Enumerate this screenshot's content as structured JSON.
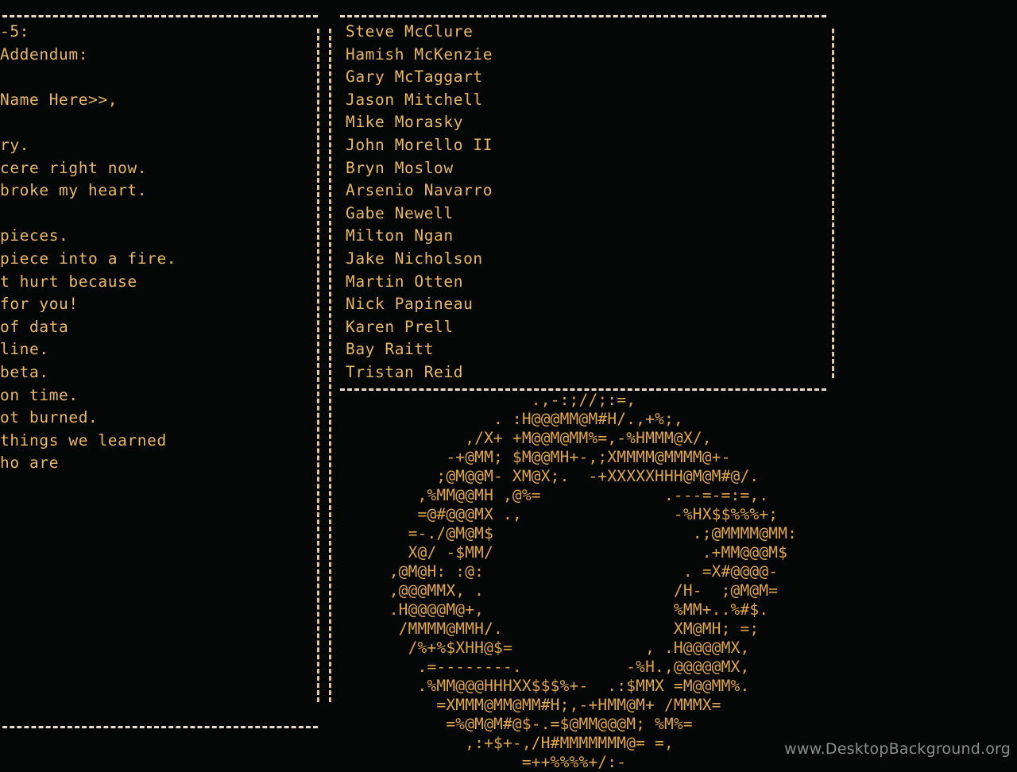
{
  "meta": {
    "background_color": "#050707",
    "text_color": "#e9b866",
    "rule_color": "#e6dcc8",
    "ascii_color": "#e0a64a",
    "watermark_color": "#8d8d8d"
  },
  "letter": {
    "title": "left-letter-panel",
    "lines": [
      "-5:",
      "Addendum:",
      "",
      "Name Here>>,",
      "",
      "ry.",
      "cere right now.",
      "broke my heart.",
      "",
      "pieces.",
      "piece into a fire.",
      "t hurt because",
      "for you!",
      "of data",
      "line.",
      "beta.",
      "on time.",
      "ot burned.",
      "things we learned",
      "ho are"
    ]
  },
  "credits": {
    "title": "credits-names-panel",
    "names": [
      "Steve McClure",
      "Hamish McKenzie",
      "Gary McTaggart",
      "Jason Mitchell",
      "Mike Morasky",
      "John Morello II",
      "Bryn Moslow",
      "Arsenio Navarro",
      "Gabe Newell",
      "Milton Ngan",
      "Jake Nicholson",
      "Martin Otten",
      "Nick Papineau",
      "Karen Prell",
      "Bay Raitt",
      "Tristan Reid"
    ]
  },
  "ascii_art": {
    "name": "aperture-science-ascii-logo",
    "lines": [
      "                    .,-:;//;:=,",
      "                . :H@@@MM@M#H/.,+%;,",
      "             ,/X+ +M@@M@MM%=,-%HMMM@X/,",
      "           -+@MM; $M@@MH+-,;XMMMM@MMMM@+-",
      "          ;@M@@M- XM@X;.  -+XXXXXHHH@M@M#@/.",
      "        ,%MM@@MH ,@%=             .---=-=:=,.",
      "        =@#@@@MX .,                -%HX$$%%%+;",
      "       =-./@M@M$                     .;@MMMM@MM:",
      "       X@/ -$MM/                      .+MM@@@M$",
      "     ,@M@H: :@:                     . =X#@@@@-",
      "     ,@@@MMX, .                    /H-  ;@M@M=",
      "     .H@@@@M@+,                    %MM+..%#$.",
      "      /MMMM@MMH/.                  XM@MH; =;",
      "       /%+%$XHH@$=              , .H@@@@MX,",
      "        .=--------.           -%H.,@@@@@MX,",
      "        .%MM@@@HHHXX$$$%+-  .:$MMX =M@@MM%.",
      "          =XMMM@MM@MM#H;,-+HMM@M+ /MMMX=",
      "           =%@M@M#@$-.=$@MM@@@M; %M%=",
      "             ,:+$+-,/H#MMMMMMM@= =,",
      "                   =++%%%%+/:-"
    ]
  },
  "watermark": {
    "text": "www.DesktopBackground.org"
  }
}
